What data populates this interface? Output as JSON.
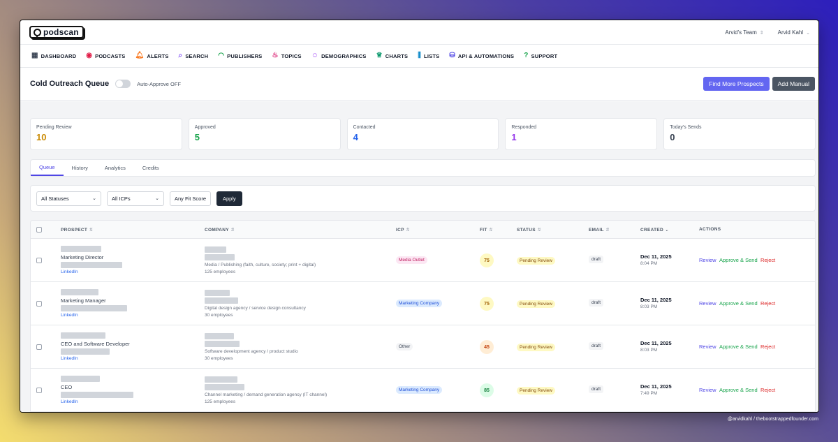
{
  "app": {
    "logo": "podscan",
    "team": "Arvid's Team",
    "user": "Arvid Kahl"
  },
  "nav": [
    {
      "icon": "▦",
      "label": "DASHBOARD",
      "color": "#374151"
    },
    {
      "icon": "◉",
      "label": "PODCASTS",
      "color": "#e11d48"
    },
    {
      "icon": "🔔︎",
      "label": "ALERTS",
      "color": "#f97316"
    },
    {
      "icon": "⌕",
      "label": "SEARCH",
      "color": "#8b5cf6"
    },
    {
      "icon": "◠",
      "label": "PUBLISHERS",
      "color": "#16a34a"
    },
    {
      "icon": "♨",
      "label": "TOPICS",
      "color": "#db2777"
    },
    {
      "icon": "☺",
      "label": "DEMOGRAPHICS",
      "color": "#a855f7"
    },
    {
      "icon": "♕",
      "label": "CHARTS",
      "color": "#059669"
    },
    {
      "icon": "⫼",
      "label": "LISTS",
      "color": "#0284c7"
    },
    {
      "icon": "⛁",
      "label": "API & AUTOMATIONS",
      "color": "#4f46e5"
    },
    {
      "icon": "?",
      "label": "SUPPORT",
      "color": "#16a34a"
    }
  ],
  "header": {
    "title": "Cold Outreach Queue",
    "toggle_label": "Auto-Approve OFF",
    "find_button": "Find More Prospects",
    "add_button": "Add Manual"
  },
  "stats": [
    {
      "label": "Pending Review",
      "value": "10",
      "color": "#ca8a04"
    },
    {
      "label": "Approved",
      "value": "5",
      "color": "#16a34a"
    },
    {
      "label": "Contacted",
      "value": "4",
      "color": "#2563eb"
    },
    {
      "label": "Responded",
      "value": "1",
      "color": "#9333ea"
    },
    {
      "label": "Today's Sends",
      "value": "0",
      "color": "#374151"
    }
  ],
  "tabs": [
    "Queue",
    "History",
    "Analytics",
    "Credits"
  ],
  "filters": {
    "status": "All Statuses",
    "icp": "All ICPs",
    "fit": "Any Fit Score",
    "apply": "Apply"
  },
  "columns": {
    "prospect": "PROSPECT",
    "company": "COMPANY",
    "icp": "ICP",
    "fit": "FIT",
    "status": "STATUS",
    "email": "EMAIL",
    "created": "CREATED",
    "actions": "ACTIONS"
  },
  "rows": [
    {
      "title": "Marketing Director",
      "link": "LinkedIn",
      "description": "Media / Publishing (faith, culture, society; print + digital)",
      "employees": "125 employees",
      "icp": "Media Outlet",
      "icp_bg": "#fce7f3",
      "icp_fg": "#be185d",
      "fit": "75",
      "fit_bg": "#fef9c3",
      "fit_fg": "#a16207",
      "status": "Pending Review",
      "email": "draft",
      "date": "Dec 11, 2025",
      "time": "8:04 PM"
    },
    {
      "title": "Marketing Manager",
      "link": "LinkedIn",
      "description": "Digital design agency / service design consultancy",
      "employees": "30 employees",
      "icp": "Marketing Company",
      "icp_bg": "#dbeafe",
      "icp_fg": "#1d4ed8",
      "fit": "75",
      "fit_bg": "#fef9c3",
      "fit_fg": "#a16207",
      "status": "Pending Review",
      "email": "draft",
      "date": "Dec 11, 2025",
      "time": "8:03 PM"
    },
    {
      "title": "CEO and Software Developer",
      "link": "LinkedIn",
      "description": "Software development agency / product studio",
      "employees": "30 employees",
      "icp": "Other",
      "icp_bg": "#f3f4f6",
      "icp_fg": "#374151",
      "fit": "45",
      "fit_bg": "#ffedd5",
      "fit_fg": "#c2410c",
      "status": "Pending Review",
      "email": "draft",
      "date": "Dec 11, 2025",
      "time": "8:03 PM"
    },
    {
      "title": "CEO",
      "link": "LinkedIn",
      "description": "Channel marketing / demand generation agency (IT channel)",
      "employees": "125 employees",
      "icp": "Marketing Company",
      "icp_bg": "#dbeafe",
      "icp_fg": "#1d4ed8",
      "fit": "85",
      "fit_bg": "#dcfce7",
      "fit_fg": "#15803d",
      "status": "Pending Review",
      "email": "draft",
      "date": "Dec 11, 2025",
      "time": "7:49 PM"
    }
  ],
  "row_actions": {
    "review": "Review",
    "approve": "Approve & Send",
    "reject": "Reject"
  },
  "credit": "@arvidkahl / thebootstrappedfounder.com"
}
